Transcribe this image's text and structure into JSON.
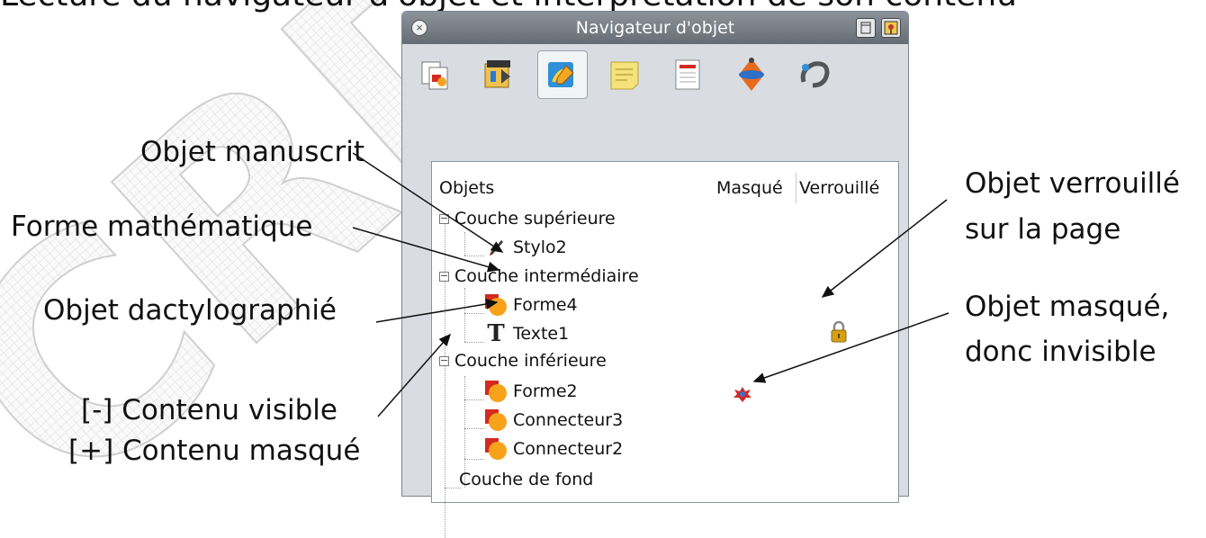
{
  "caption": "Lecture du navigateur d'objet et interprétation de son contenu",
  "window": {
    "title": "Navigateur d'objet",
    "close_icon": "close-icon",
    "toolbar_icons": [
      "page-sorter-icon",
      "attachments-icon",
      "object-navigator-icon",
      "notes-icon",
      "properties-icon",
      "gadgets-icon",
      "tools-icon"
    ]
  },
  "columns": {
    "objets": "Objets",
    "masque": "Masqué",
    "verrouille": "Verrouillé"
  },
  "tree": [
    {
      "label": "Couche supérieure",
      "type": "layer",
      "expander": "−"
    },
    {
      "label": "Stylo2",
      "type": "pen"
    },
    {
      "label": "Couche intermédiaire",
      "type": "layer",
      "expander": "−"
    },
    {
      "label": "Forme4",
      "type": "shape"
    },
    {
      "label": "Texte1",
      "type": "text"
    },
    {
      "label": "Couche inférieure",
      "type": "layer",
      "expander": "−"
    },
    {
      "label": "Forme2",
      "type": "shape"
    },
    {
      "label": "Connecteur3",
      "type": "shape"
    },
    {
      "label": "Connecteur2",
      "type": "shape"
    },
    {
      "label": "Couche de fond",
      "type": "layer"
    }
  ],
  "annotations": {
    "manuscrit": "Objet manuscrit",
    "math": "Forme mathématique",
    "dactylo": "Objet dactylographié",
    "visible": "[-] Contenu visible",
    "masque_contenu": "[+] Contenu masqué",
    "verrouille_1": "Objet verrouillé",
    "verrouille_2": "sur la page",
    "masque_1": "Objet masqué,",
    "masque_2": "donc invisible"
  },
  "watermark_text": "CRD",
  "colors": {
    "title_bar": "#6f767e",
    "shape_red": "#d32b1f",
    "shape_orange": "#f7a21b",
    "lock_gold": "#d4a017"
  }
}
